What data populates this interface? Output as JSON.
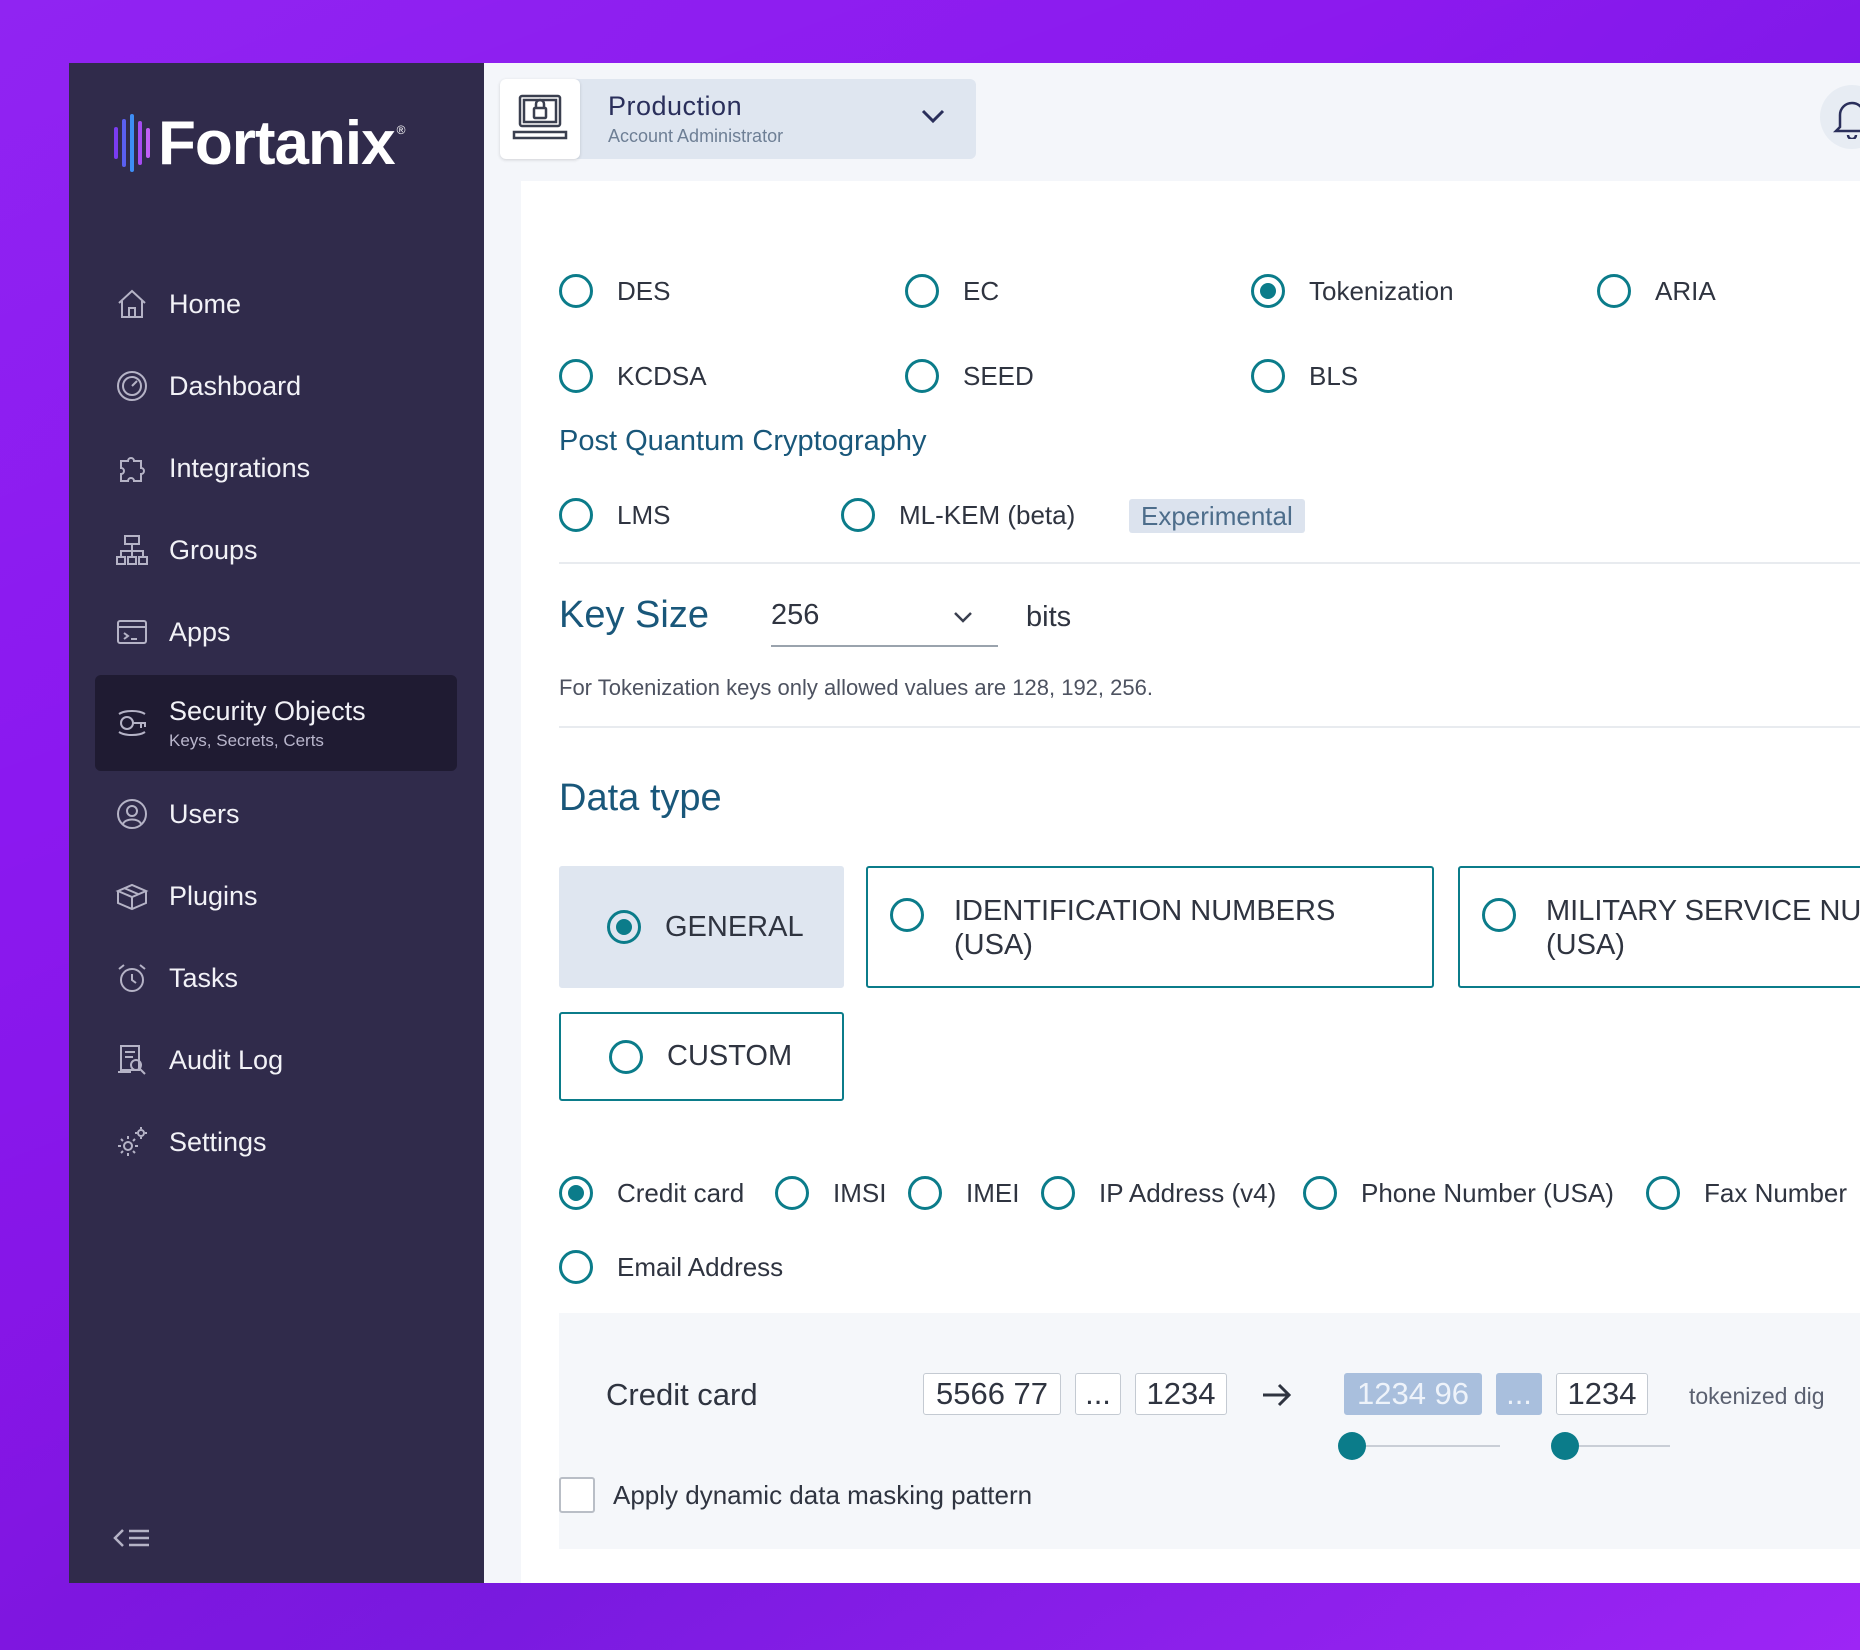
{
  "brand": {
    "name": "Fortanix"
  },
  "account": {
    "title": "Production",
    "role": "Account Administrator"
  },
  "sidebar": {
    "items": [
      {
        "label": "Home"
      },
      {
        "label": "Dashboard"
      },
      {
        "label": "Integrations"
      },
      {
        "label": "Groups"
      },
      {
        "label": "Apps"
      },
      {
        "label": "Security Objects",
        "sub": "Keys, Secrets, Certs"
      },
      {
        "label": "Users"
      },
      {
        "label": "Plugins"
      },
      {
        "label": "Tasks"
      },
      {
        "label": "Audit Log"
      },
      {
        "label": "Settings"
      }
    ]
  },
  "algorithms": {
    "row1": [
      "DES",
      "EC",
      "Tokenization",
      "ARIA"
    ],
    "row2": [
      "KCDSA",
      "SEED",
      "BLS"
    ],
    "selected": "Tokenization"
  },
  "pqc": {
    "title": "Post Quantum Cryptography",
    "options": [
      "LMS",
      "ML-KEM (beta)"
    ],
    "badge": "Experimental"
  },
  "key_size": {
    "label": "Key Size",
    "value": "256",
    "unit": "bits",
    "hint": "For Tokenization keys only allowed values are 128, 192, 256."
  },
  "data_type": {
    "title": "Data type",
    "cards": [
      {
        "label": "GENERAL"
      },
      {
        "line1": "IDENTIFICATION NUMBERS",
        "line2": "(USA)"
      },
      {
        "line1": "MILITARY SERVICE NUM",
        "line2": "(USA)"
      },
      {
        "label": "CUSTOM"
      }
    ],
    "selected": "GENERAL"
  },
  "formats": {
    "options": [
      "Credit card",
      "IMSI",
      "IMEI",
      "IP Address (v4)",
      "Phone Number (USA)",
      "Fax Number",
      "Email Address"
    ],
    "selected": "Credit card"
  },
  "preview": {
    "label": "Credit card",
    "input": [
      "5566 77",
      "...",
      "1234"
    ],
    "output": [
      "1234 96",
      "...",
      "1234"
    ],
    "note": "tokenized dig",
    "slider_left": 0.0,
    "slider_right": 0.0
  },
  "masking": {
    "label": "Apply dynamic data masking pattern",
    "checked": false
  },
  "colors": {
    "accent": "#0b7c8a",
    "sidebar": "#302b4b",
    "title": "#19577a"
  }
}
